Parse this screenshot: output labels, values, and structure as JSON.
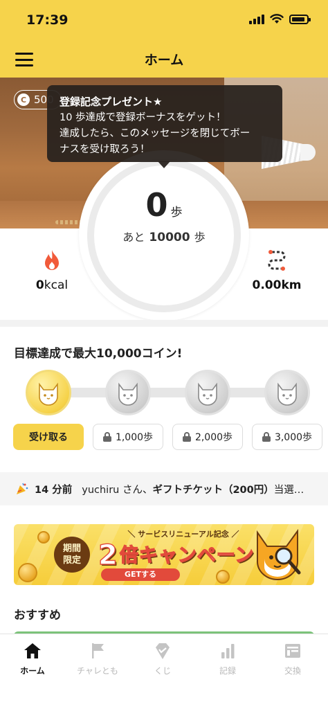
{
  "status": {
    "time": "17:39"
  },
  "header": {
    "title": "ホーム"
  },
  "coins": {
    "amount": "500",
    "icon_letter": "C"
  },
  "tooltip": {
    "title": "登録記念プレゼント★",
    "line1": "10 歩達成で登録ボーナスをゲット！",
    "line2": "達成したら、このメッセージを閉じてボー",
    "line3": "ナスを受け取ろう！"
  },
  "steps": {
    "value": "0",
    "unit": "歩",
    "remaining_prefix": "あと",
    "remaining_value": "10000",
    "remaining_unit": "歩",
    "goal": 10000,
    "progress": 0
  },
  "stats": {
    "kcal": {
      "value": "0",
      "unit": "kcal",
      "icon": "flame-icon"
    },
    "distance": {
      "value": "0.00",
      "unit": "km",
      "icon": "route-icon"
    }
  },
  "goal": {
    "title": "目標達成で最大10,000コイン!",
    "claim_label": "受け取る",
    "milestones": [
      "1,000歩",
      "2,000歩",
      "3,000歩"
    ]
  },
  "news": {
    "time": "14 分前",
    "user": "yuchiru さん、",
    "item": "ギフトチケット（200円）",
    "suffix": "当選…"
  },
  "banner": {
    "limited_1": "期間",
    "limited_2": "限定",
    "ribbon": "＼ サービスリニューアル記念 ／",
    "big": "2",
    "main": "倍キャンペーン",
    "cta": "GETする"
  },
  "recommended": {
    "title": "おすすめ"
  },
  "tabs": [
    {
      "label": "ホーム",
      "icon": "home-icon",
      "active": true
    },
    {
      "label": "チャレとも",
      "icon": "flag-icon",
      "active": false
    },
    {
      "label": "くじ",
      "icon": "lottery-icon",
      "active": false
    },
    {
      "label": "記録",
      "icon": "chart-icon",
      "active": false
    },
    {
      "label": "交換",
      "icon": "exchange-icon",
      "active": false
    }
  ],
  "colors": {
    "brand": "#f6d34b",
    "accent_red": "#e24a3b",
    "flame": "#f15a3a"
  }
}
